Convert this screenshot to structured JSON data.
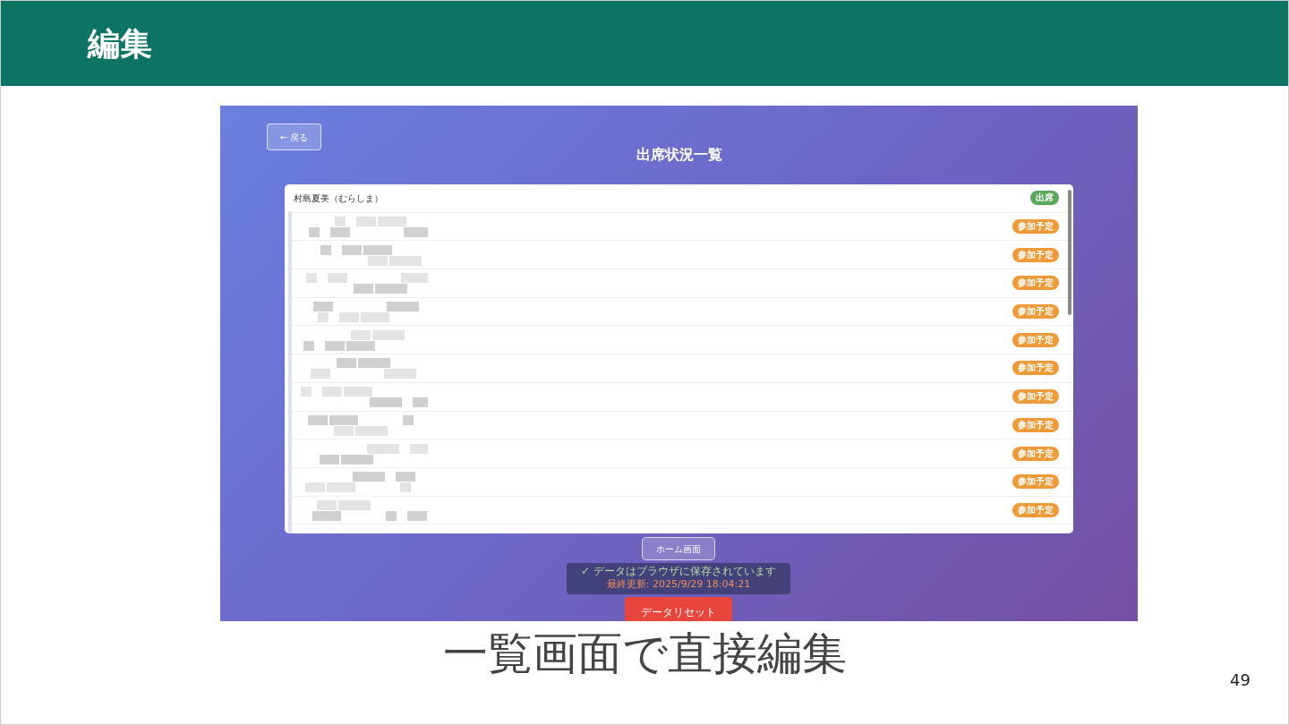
{
  "slide": {
    "title": "編集",
    "caption": "一覧画面で直接編集",
    "page_number": "49"
  },
  "app": {
    "back_button": "← 戻る",
    "title": "出席状況一覧",
    "rows": [
      {
        "name": "村島夏美（むらしま）",
        "status": "出席",
        "kind": "present"
      },
      {
        "kind": "planned",
        "status": "参加予定"
      },
      {
        "kind": "planned",
        "status": "参加予定"
      },
      {
        "kind": "planned",
        "status": "参加予定"
      },
      {
        "kind": "planned",
        "status": "参加予定"
      },
      {
        "kind": "planned",
        "status": "参加予定"
      },
      {
        "kind": "planned",
        "status": "参加予定"
      },
      {
        "kind": "planned",
        "status": "参加予定"
      },
      {
        "kind": "planned",
        "status": "参加予定"
      },
      {
        "kind": "planned",
        "status": "参加予定"
      },
      {
        "kind": "planned",
        "status": "参加予定"
      },
      {
        "kind": "planned",
        "status": "参加予定"
      }
    ],
    "home_button": "ホーム画面",
    "reset_button": "データリセット",
    "toast": {
      "message": "✓ データはブラウザに保存されています",
      "updated": "最終更新: 2025/9/29 18:04:21"
    }
  }
}
